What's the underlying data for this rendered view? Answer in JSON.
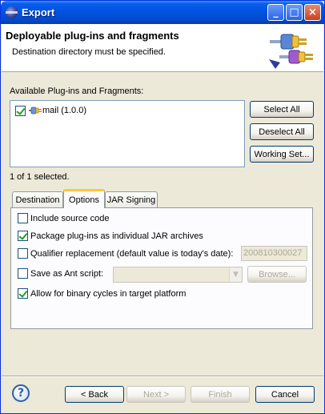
{
  "window": {
    "title": "Export",
    "controls": {
      "minimize": "_",
      "maximize": "□",
      "close": "×"
    }
  },
  "header": {
    "title": "Deployable plug-ins and fragments",
    "message": "Destination directory must be specified.",
    "graphic_icon": "plugin-export-wizard-icon"
  },
  "plugins": {
    "label": "Available Plug-ins and Fragments:",
    "items": [
      {
        "label": "mail (1.0.0)",
        "checked": true,
        "icon": "plugin-icon"
      }
    ],
    "selected_count": "1 of 1 selected."
  },
  "side_buttons": {
    "select_all": "Select All",
    "deselect_all": "Deselect All",
    "working_set": "Working Set..."
  },
  "tabs": [
    {
      "label": "Destination",
      "active": false
    },
    {
      "label": "Options",
      "active": true
    },
    {
      "label": "JAR Signing",
      "active": false
    }
  ],
  "options": {
    "include_source": {
      "label": "Include source code",
      "checked": false
    },
    "package_jar": {
      "label": "Package plug-ins as individual JAR archives",
      "checked": true
    },
    "qualifier": {
      "label": "Qualifier replacement (default value is today's date):",
      "checked": false,
      "value": "200810300027"
    },
    "ant_script": {
      "label": "Save as Ant script:",
      "checked": false,
      "value": "",
      "browse_label": "Browse..."
    },
    "binary_cycles": {
      "label": "Allow for binary cycles in target platform",
      "checked": true
    }
  },
  "footer": {
    "help_icon": "help-icon",
    "help_glyph": "?",
    "back": "< Back",
    "next": "Next >",
    "finish": "Finish",
    "cancel": "Cancel"
  },
  "colors": {
    "titlebar": "#0055e5",
    "dialog_bg": "#ece9d8",
    "tab_highlight": "#ffc83c",
    "check_mark": "#21a121"
  }
}
